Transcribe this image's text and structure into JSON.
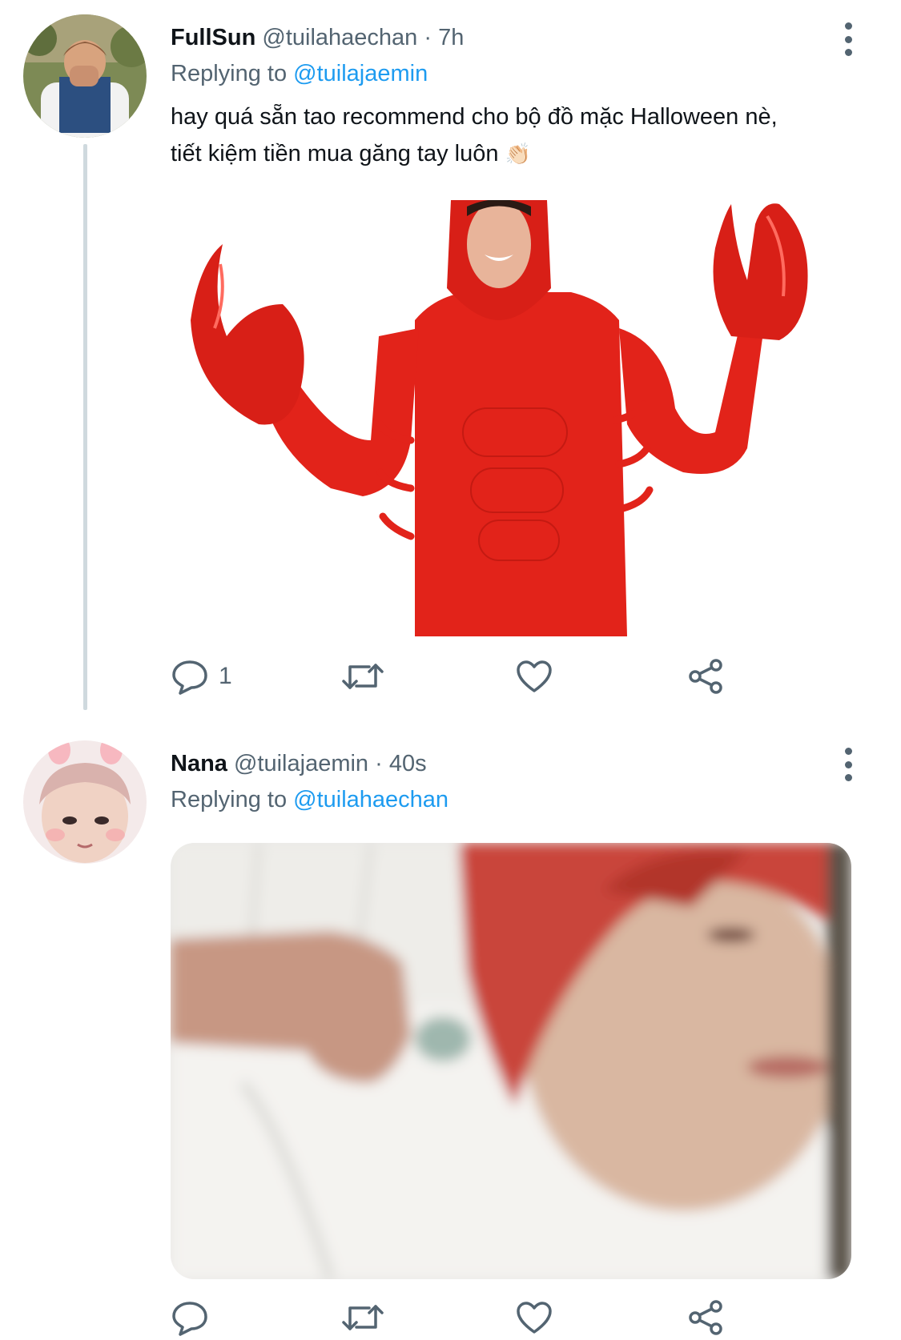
{
  "tweets": [
    {
      "display_name": "FullSun",
      "handle": "@tuilahaechan",
      "separator": "·",
      "time": "7h",
      "replying_prefix": "Replying to",
      "replying_to": "@tuilajaemin",
      "text_line1": "hay quá sẵn tao recommend cho bộ đồ mặc Halloween nè,",
      "text_line2": "tiết kiệm tiền mua găng tay luôn",
      "text_emoji": "👏🏻",
      "reply_count": "1"
    },
    {
      "display_name": "Nana",
      "handle": "@tuilajaemin",
      "separator": "·",
      "time": "40s",
      "replying_prefix": "Replying to",
      "replying_to": "@tuilahaechan",
      "reply_count": ""
    }
  ],
  "icons": {
    "more": "more-vertical-icon",
    "reply": "reply-icon",
    "retweet": "retweet-icon",
    "like": "heart-icon",
    "share": "share-icon"
  },
  "colors": {
    "link": "#1d9bf0",
    "secondary_text": "#536471",
    "primary_text": "#0f1419",
    "thread_line": "#cfd9de",
    "costume_red": "#e2231a"
  }
}
